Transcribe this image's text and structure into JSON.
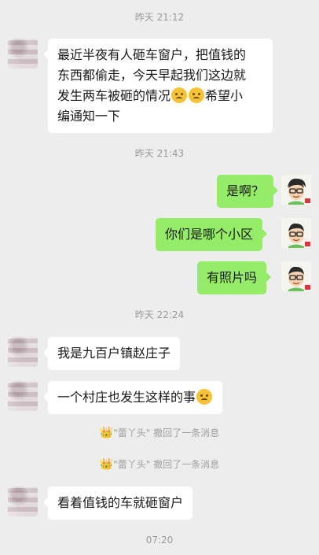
{
  "timestamps": [
    "昨天 21:12",
    "昨天 21:43",
    "昨天 22:24",
    "07:20"
  ],
  "messages": [
    {
      "side": "left",
      "lines": [
        "最近半夜有人砸车窗户，把值钱的",
        "东西都偷走，今天早起我们这边就",
        "发生两车被砸的情况",
        "希望小",
        "编通知一下"
      ]
    },
    {
      "side": "right",
      "text": "是啊？"
    },
    {
      "side": "right",
      "text": "你们是哪个小区"
    },
    {
      "side": "right",
      "text": "有照片吗"
    },
    {
      "side": "left",
      "text": "我是九百户镇赵庄子"
    },
    {
      "side": "left",
      "text": "一个村庄也发生这样的事"
    },
    {
      "side": "left",
      "text": "看着值钱的车就砸窗户"
    }
  ],
  "recall_notices": [
    {
      "crown": "👑",
      "name": "\"蕾丫头\"",
      "text": " 撤回了一条消息"
    },
    {
      "crown": "👑",
      "name": "\"蕾丫头\"",
      "text": " 撤回了一条消息"
    }
  ],
  "icons": {
    "emoji": "pleading-face-emoji",
    "crown": "crown-emoji"
  },
  "colors": {
    "bg": "#ededed",
    "bubble_me": "#95ec69",
    "bubble_other": "#ffffff"
  }
}
